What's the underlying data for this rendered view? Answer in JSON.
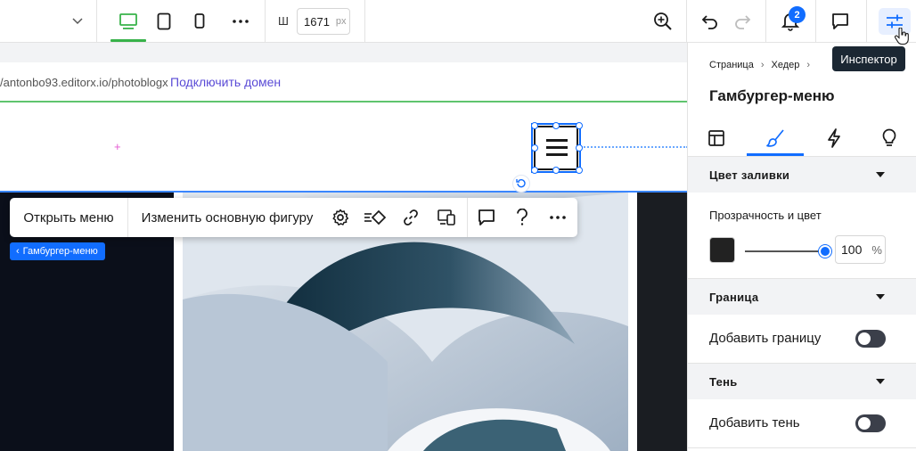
{
  "toolbar": {
    "width_label": "Ш",
    "width_value": "1671",
    "width_unit": "px",
    "notifications_count": "2",
    "inspector_tooltip": "Инспектор"
  },
  "canvas": {
    "site_url": "/antonbo93.editorx.io/photoblogx",
    "connect_domain": "Подключить домен",
    "context_toolbar": {
      "open_menu": "Открыть меню",
      "change_shape": "Изменить основную фигуру"
    },
    "selected_tag": "Гамбургер-меню"
  },
  "panel": {
    "breadcrumb": [
      "Страница",
      "Хедер"
    ],
    "title": "Гамбургер-меню",
    "sections": {
      "fill": {
        "title": "Цвет заливки",
        "label": "Прозрачность и цвет",
        "opacity": "100",
        "unit": "%",
        "color": "#222222"
      },
      "border": {
        "title": "Граница",
        "toggle_label": "Добавить границу"
      },
      "shadow": {
        "title": "Тень",
        "toggle_label": "Добавить тень"
      }
    }
  },
  "colors": {
    "accent": "#116dff",
    "device_active": "#38b24a",
    "link": "#5a4bd6"
  }
}
